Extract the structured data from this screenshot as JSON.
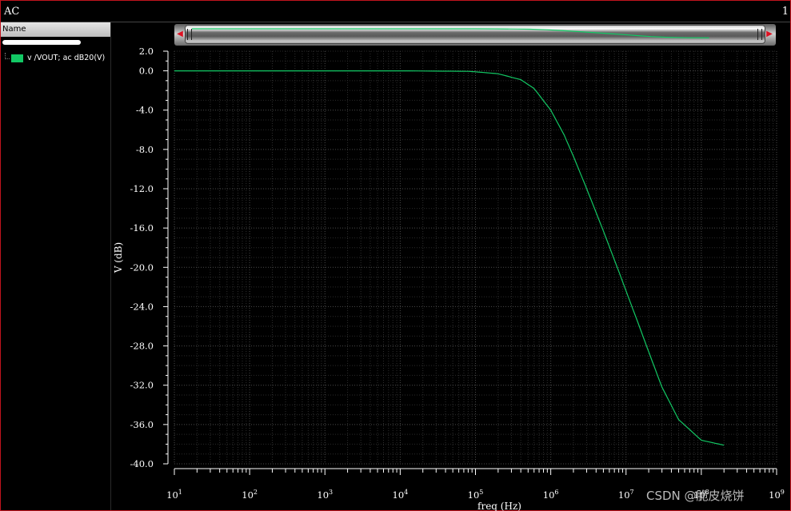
{
  "window": {
    "title": "AC",
    "plot_number": "1"
  },
  "legend": {
    "header": "Name",
    "items": [
      {
        "label": "v /VOUT; ac dB20(V)",
        "color": "#12c864"
      }
    ]
  },
  "chart_data": {
    "type": "line",
    "x_scale": "log",
    "xlabel": "freq (Hz)",
    "ylabel": "V (dB)",
    "xlim": [
      10,
      1000000000
    ],
    "ylim": [
      -40.0,
      2.0
    ],
    "x_ticks": [
      {
        "base": "10",
        "exp": "1"
      },
      {
        "base": "10",
        "exp": "2"
      },
      {
        "base": "10",
        "exp": "3"
      },
      {
        "base": "10",
        "exp": "4"
      },
      {
        "base": "10",
        "exp": "5"
      },
      {
        "base": "10",
        "exp": "6"
      },
      {
        "base": "10",
        "exp": "7"
      },
      {
        "base": "10",
        "exp": "8"
      },
      {
        "base": "10",
        "exp": "9"
      }
    ],
    "y_ticks": [
      "2.0",
      "0.0",
      "-4.0",
      "-8.0",
      "-12.0",
      "-16.0",
      "-20.0",
      "-24.0",
      "-28.0",
      "-32.0",
      "-36.0",
      "-40.0"
    ],
    "grid": true,
    "background": "#000000",
    "series": [
      {
        "name": "v /VOUT; ac dB20(V)",
        "color": "#12c864",
        "x": [
          10,
          100,
          1000,
          10000,
          80000,
          100000,
          200000,
          400000,
          600000,
          1000000,
          1500000,
          2000000,
          3000000,
          5000000,
          8000000,
          10000000,
          15000000,
          20000000,
          30000000,
          50000000,
          100000000,
          200000000
        ],
        "y": [
          0.0,
          0.0,
          0.0,
          0.0,
          -0.05,
          -0.1,
          -0.3,
          -0.9,
          -1.8,
          -4.0,
          -6.5,
          -8.7,
          -12.0,
          -16.3,
          -20.4,
          -22.4,
          -26.0,
          -28.6,
          -32.2,
          -35.5,
          -37.6,
          -38.1
        ]
      }
    ]
  },
  "watermark": "CSDN @脆皮烧饼"
}
